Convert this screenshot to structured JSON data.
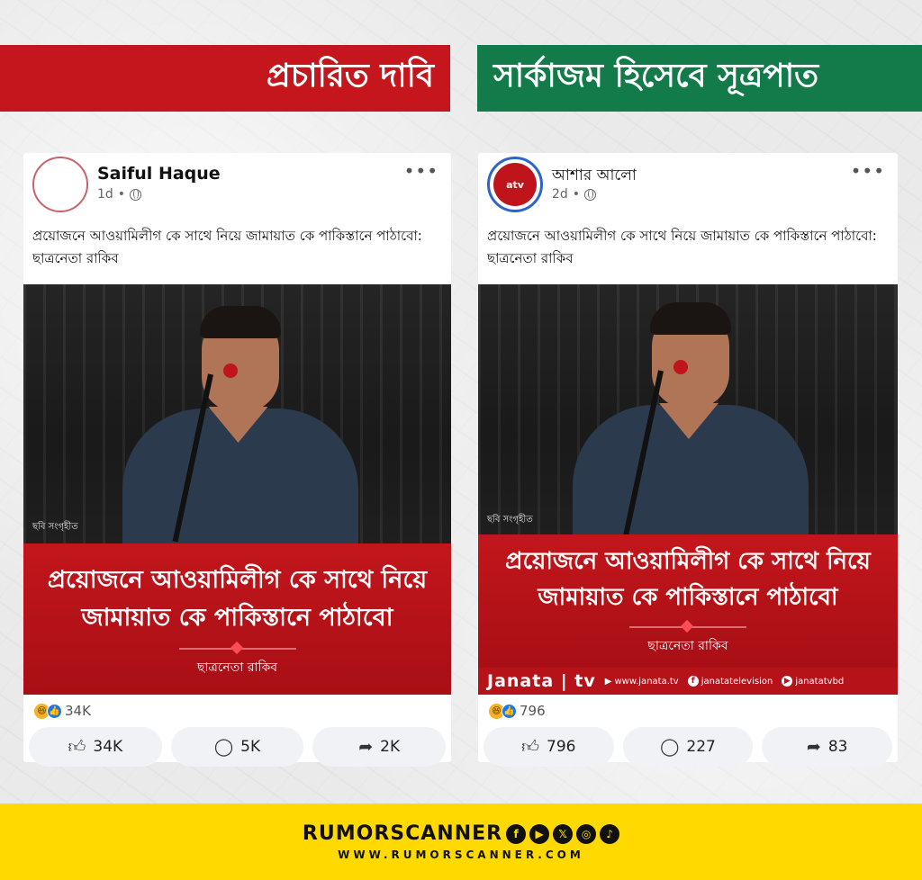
{
  "banners": {
    "left": "প্রচারিত দাবি",
    "right": "সার্কাজম হিসেবে সূত্রপাত"
  },
  "posts": [
    {
      "author": "Saiful Haque",
      "time": "1d",
      "text": "প্রয়োজনে আওয়ামিলীগ কে সাথে নিয়ে জামায়াত কে পাকিস্তানে পাঠাবো: ছাত্রনেতা রাকিব",
      "photo_credit": "ছবি সংগৃহীত",
      "headline_line1": "প্রয়োজনে আওয়ামিলীগ কে সাথে নিয়ে",
      "headline_line2": "জামায়াত কে পাকিস্তানে পাঠাবো",
      "byline": "ছাত্রনেতা রাকিব",
      "reaction_count": "34K",
      "likes": "34K",
      "comments": "5K",
      "shares": "2K"
    },
    {
      "author": "আশার আলো",
      "avatar_text": "atv",
      "time": "2d",
      "text": "প্রয়োজনে আওয়ামিলীগ কে সাথে নিয়ে জামায়াত কে পাকিস্তানে পাঠাবো: ছাত্রনেতা রাকিব",
      "photo_credit": "ছবি সংগৃহীত",
      "headline_line1": "প্রয়োজনে আওয়ামিলীগ কে সাথে নিয়ে",
      "headline_line2": "জামায়াত কে পাকিস্তানে পাঠাবো",
      "byline": "ছাত্রনেতা রাকিব",
      "brand_logo": "Janata | tv",
      "brand_site": "www.janata.tv",
      "brand_fb": "janatatelevision",
      "brand_yt": "janatatvbd",
      "reaction_count": "796",
      "likes": "796",
      "comments": "227",
      "shares": "83"
    }
  ],
  "footer": {
    "brand": "RUMORSCANNER",
    "site": "WWW.RUMORSCANNER.COM",
    "social_icons": [
      "facebook-icon",
      "youtube-icon",
      "x-icon",
      "instagram-icon",
      "tiktok-icon"
    ]
  },
  "colors": {
    "claim_red": "#c5161d",
    "source_green": "#137b49",
    "footer_yellow": "#ffd900"
  }
}
